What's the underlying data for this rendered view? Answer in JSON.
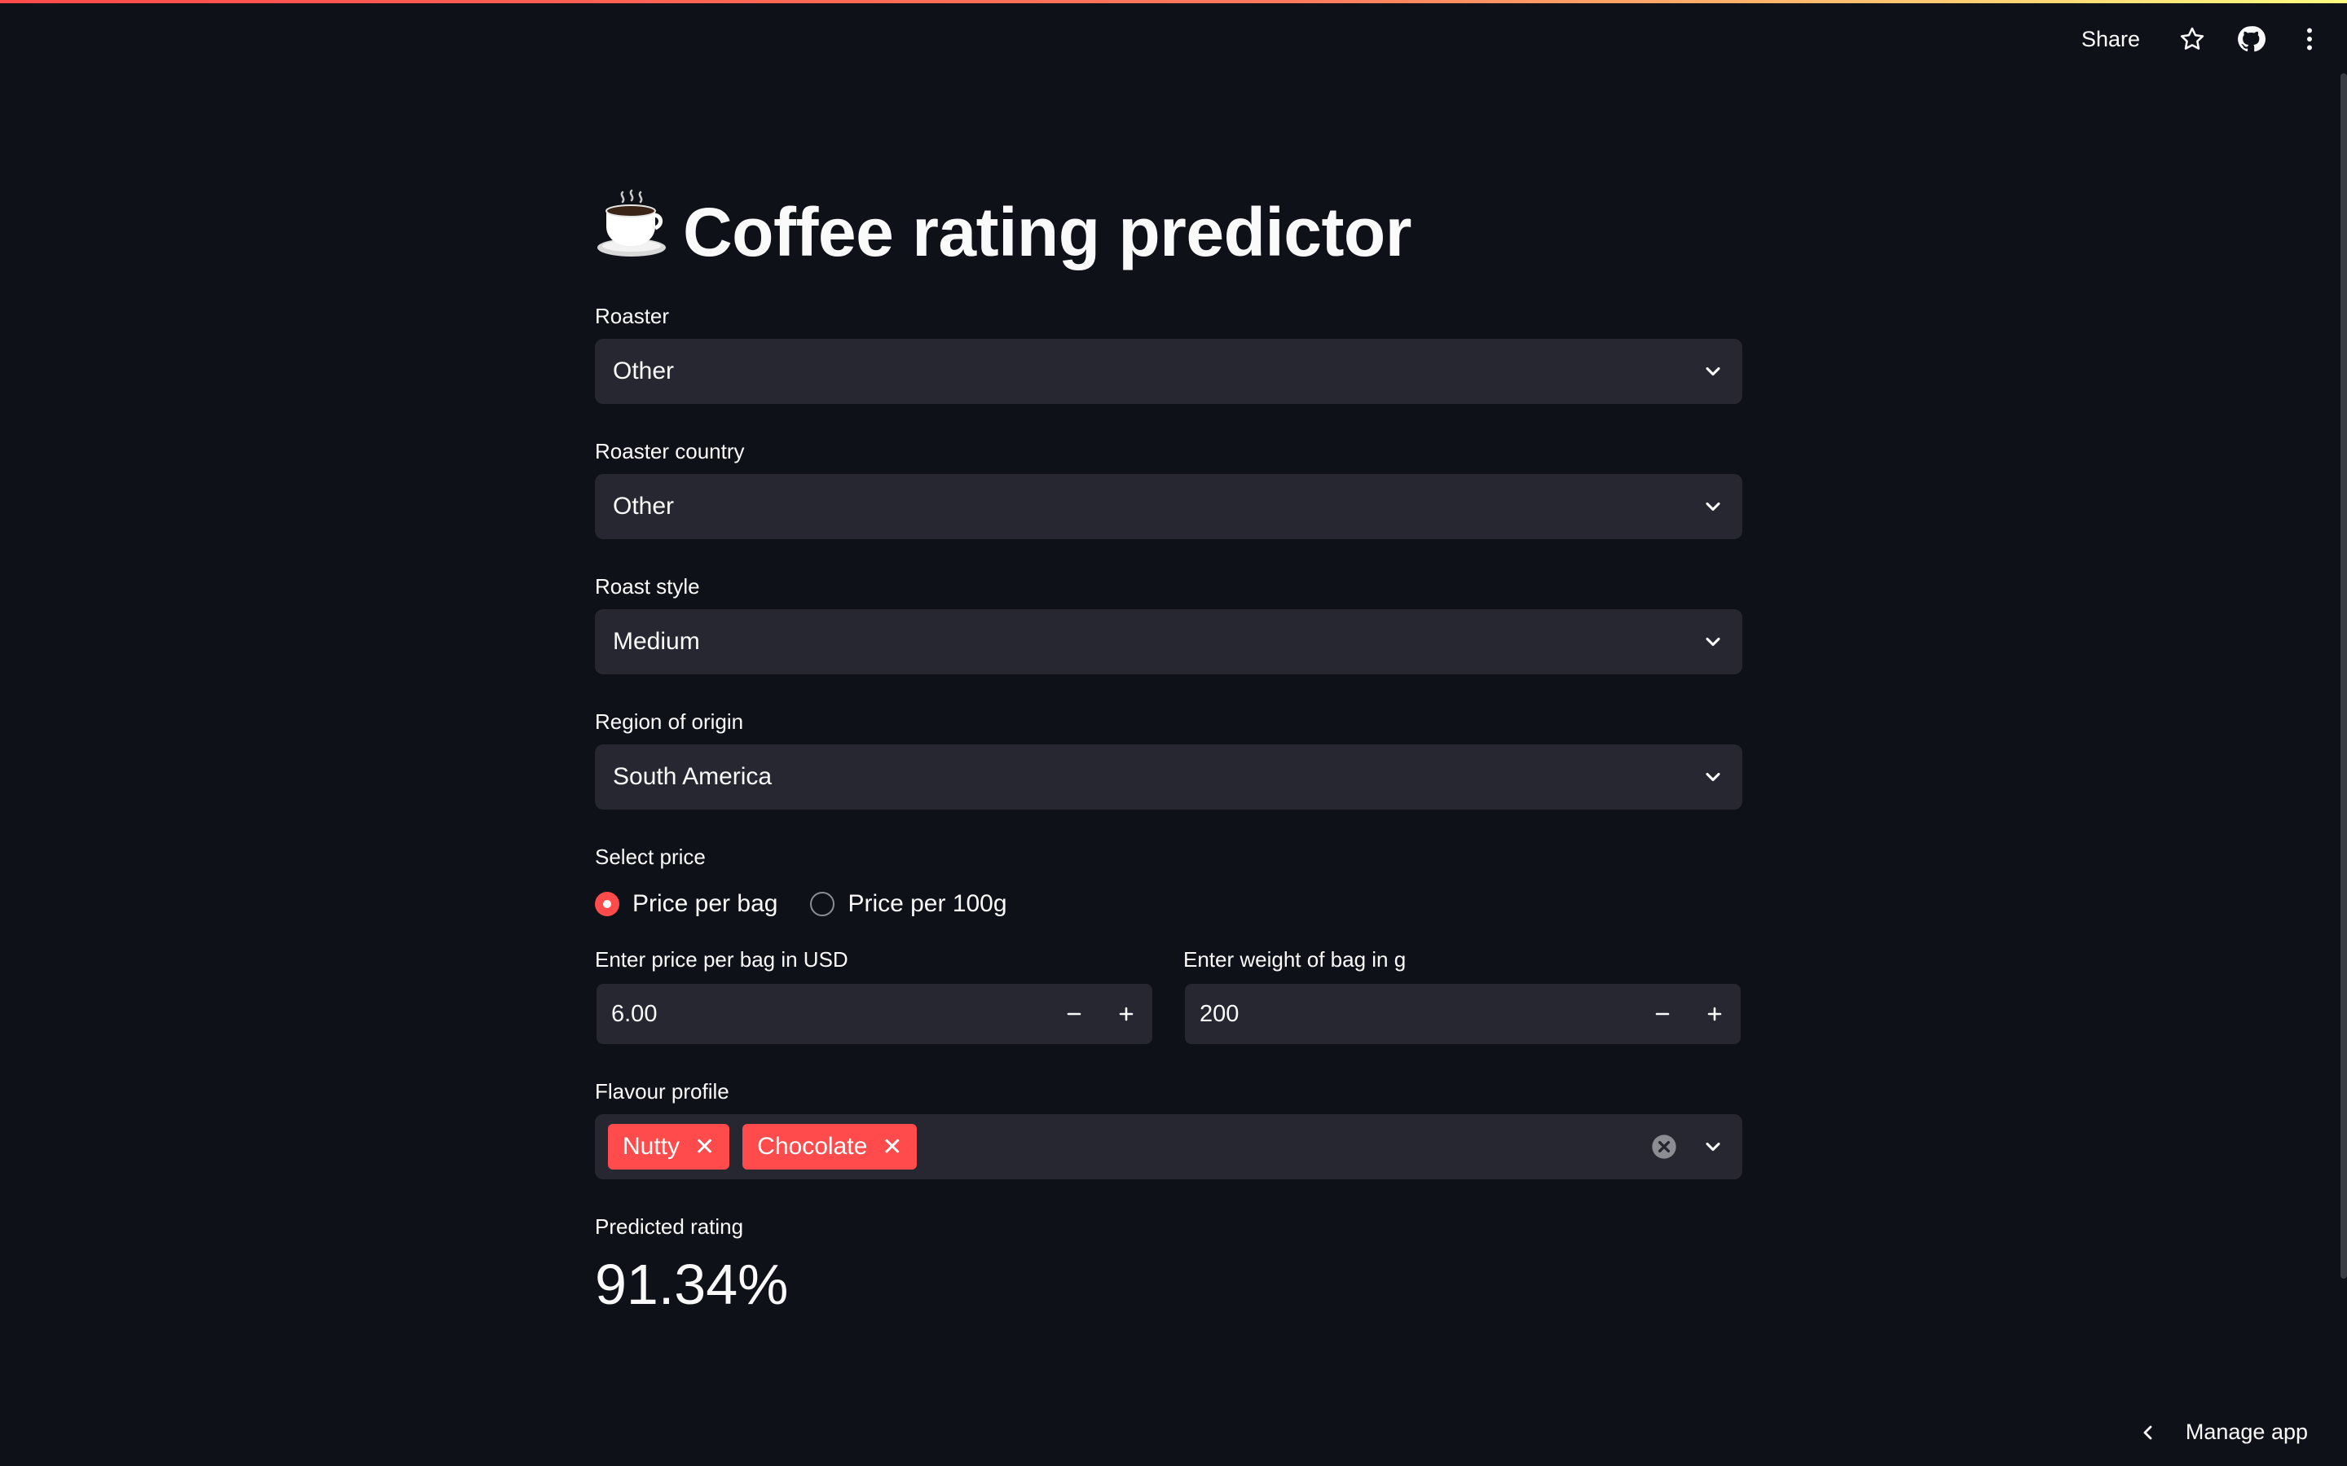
{
  "header": {
    "share_label": "Share",
    "icons": [
      "star-icon",
      "github-icon",
      "more-vertical-icon"
    ]
  },
  "title": {
    "emoji_icon": "coffee-cup-icon",
    "text": "Coffee rating predictor"
  },
  "fields": {
    "roaster": {
      "label": "Roaster",
      "value": "Other"
    },
    "roaster_country": {
      "label": "Roaster country",
      "value": "Other"
    },
    "roast_style": {
      "label": "Roast style",
      "value": "Medium"
    },
    "region": {
      "label": "Region of origin",
      "value": "South America"
    }
  },
  "price_mode": {
    "label": "Select price",
    "options": [
      "Price per bag",
      "Price per 100g"
    ],
    "selected": "Price per bag"
  },
  "price_input": {
    "label": "Enter price per bag in USD",
    "value": "6.00"
  },
  "weight_input": {
    "label": "Enter weight of bag in g",
    "value": "200"
  },
  "flavour": {
    "label": "Flavour profile",
    "tags": [
      "Nutty",
      "Chocolate"
    ]
  },
  "prediction": {
    "label": "Predicted rating",
    "value": "91.34%"
  },
  "footer": {
    "manage_label": "Manage app"
  },
  "colors": {
    "background": "#0e1117",
    "widget": "#262730",
    "accent": "#ff4b4b",
    "text": "#fafafa"
  }
}
